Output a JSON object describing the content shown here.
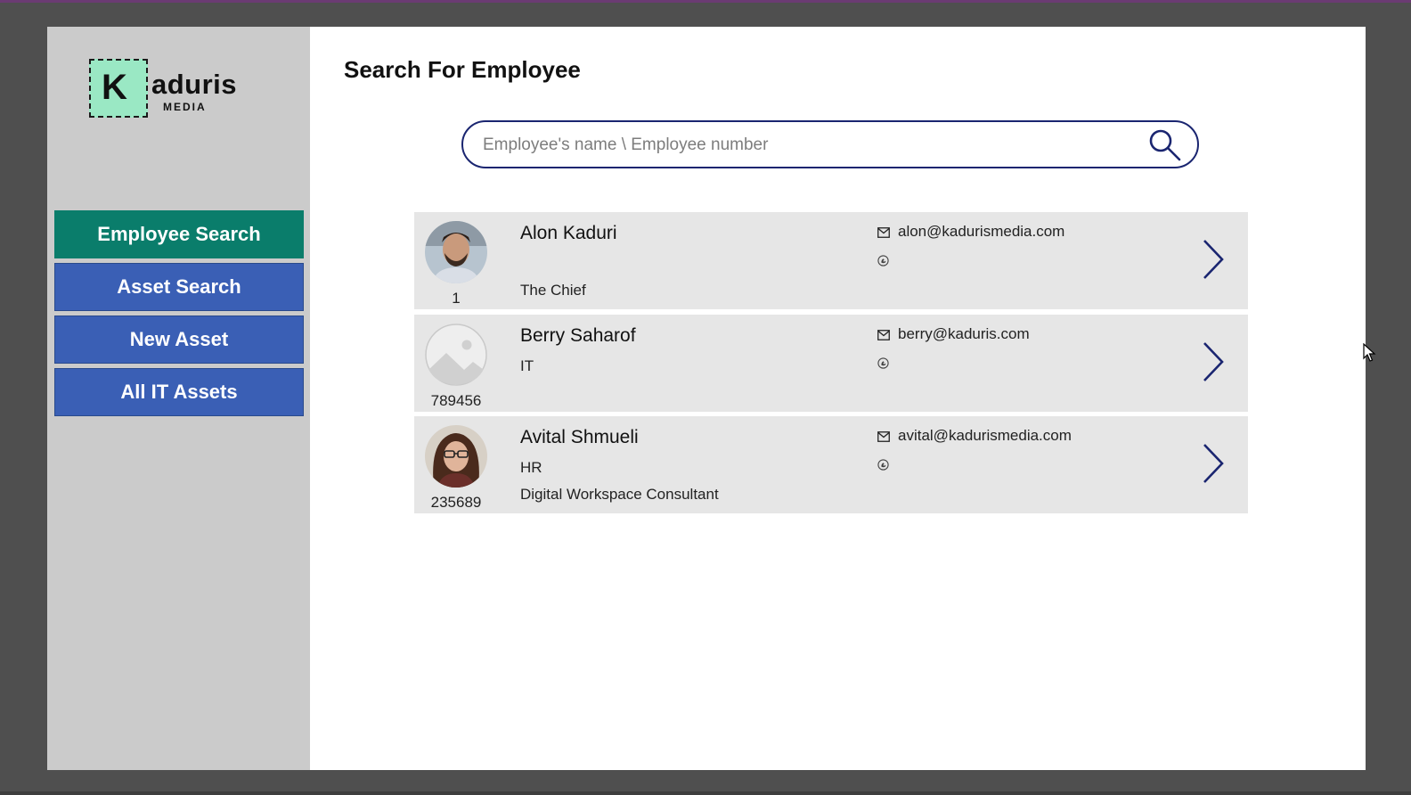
{
  "logo": {
    "letter": "K",
    "rest": "aduris",
    "sub": "MEDIA"
  },
  "colors": {
    "accent_active": "#0a7d6b",
    "nav_blue": "#3a5fb5",
    "border_navy": "#1a2570"
  },
  "sidebar": {
    "items": [
      {
        "label": "Employee Search",
        "active": true
      },
      {
        "label": "Asset Search"
      },
      {
        "label": "New Asset"
      },
      {
        "label": "All IT Assets"
      }
    ]
  },
  "main": {
    "title": "Search For Employee",
    "search": {
      "placeholder": "Employee's name \\ Employee number",
      "value": ""
    }
  },
  "employees": [
    {
      "number": "1",
      "name": "Alon Kaduri",
      "department": "",
      "title": "The Chief",
      "email": "alon@kadurismedia.com",
      "avatar": "photo"
    },
    {
      "number": "789456",
      "name": "Berry Saharof",
      "department": "IT",
      "title": "",
      "email": "berry@kaduris.com",
      "avatar": "placeholder-image"
    },
    {
      "number": "235689",
      "name": "Avital Shmueli",
      "department": "HR",
      "title": "Digital Workspace Consultant",
      "email": "avital@kadurismedia.com",
      "avatar": "photo"
    }
  ],
  "icons": {
    "search": "magnifier-icon",
    "mail": "mail-icon",
    "phone": "phone-icon",
    "chevron": "chevron-right-icon",
    "cursor": "mouse-pointer-icon"
  }
}
